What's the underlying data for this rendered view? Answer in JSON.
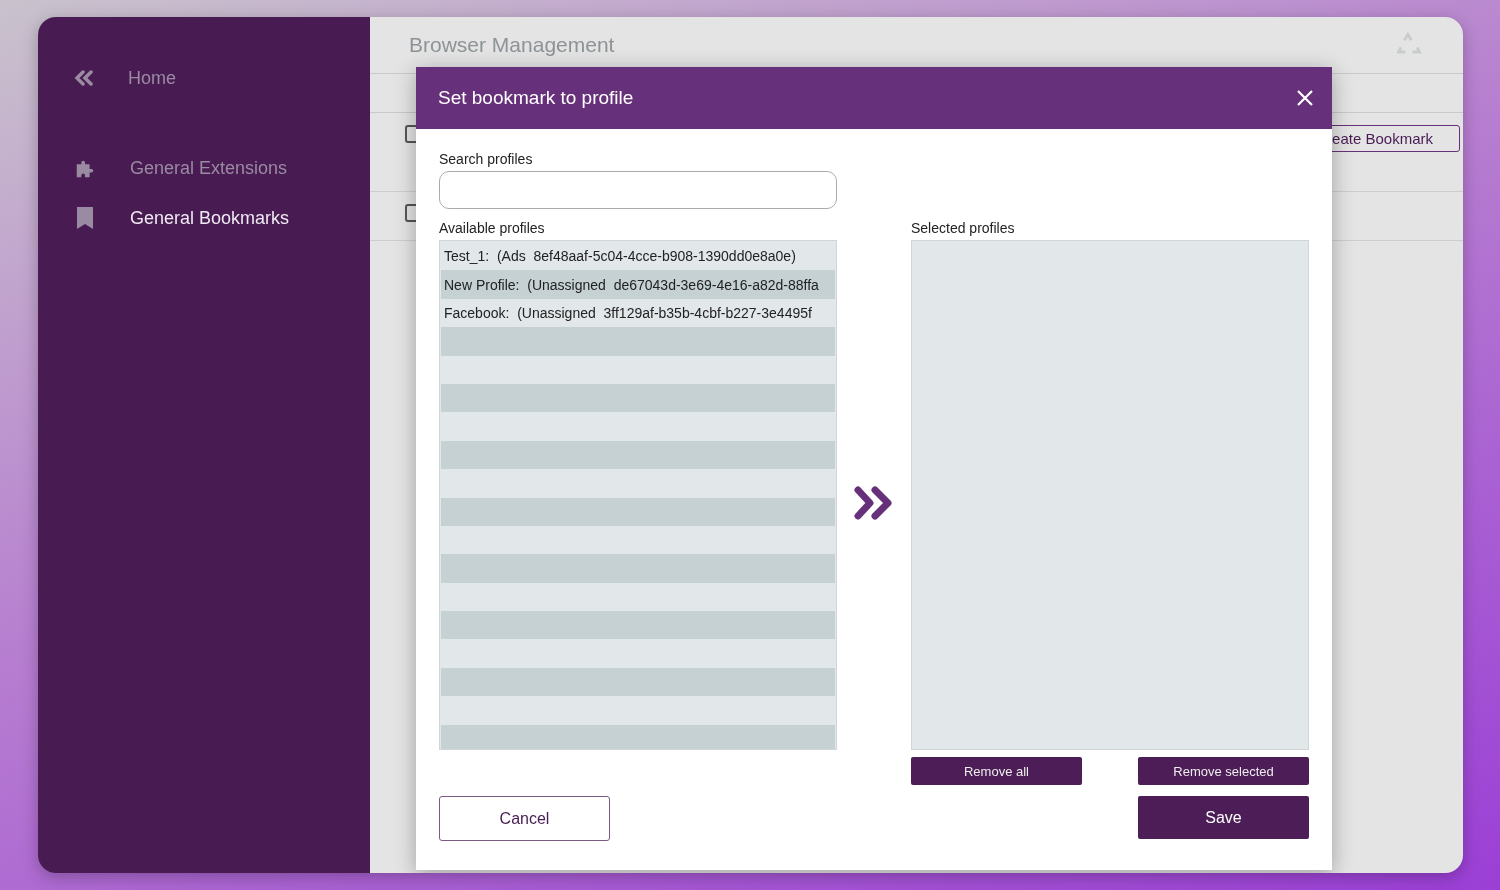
{
  "sidebar": {
    "collapse_label": "Home",
    "items": [
      {
        "kind": "extensions",
        "label": "General Extensions",
        "selected": false
      },
      {
        "kind": "bookmarks",
        "label": "General Bookmarks",
        "selected": true
      }
    ]
  },
  "main": {
    "title": "Browser Management",
    "create_button": "eate Bookmark",
    "rows": [
      {
        "checked": false
      },
      {
        "checked": false
      }
    ]
  },
  "dialog": {
    "title": "Set bookmark to profile",
    "search": {
      "label": "Search profiles"
    },
    "available": {
      "label": "Available profiles",
      "items": [
        {
          "name": "Test_1:",
          "detail": "(Ads  8ef48aaf-5c04-4cce-b908-1390dd0e8a0e)"
        },
        {
          "name": "New Profile:",
          "detail": "(Unassigned  de67043d-3e69-4e16-a82d-88ffa"
        },
        {
          "name": "Facebook:",
          "detail": "(Unassigned  3ff129af-b35b-4cbf-b227-3e4495f"
        }
      ]
    },
    "selected": {
      "label": "Selected profiles"
    },
    "remove_all": "Remove all",
    "remove_selected": "Remove selected",
    "cancel": "Cancel",
    "save": "Save"
  }
}
